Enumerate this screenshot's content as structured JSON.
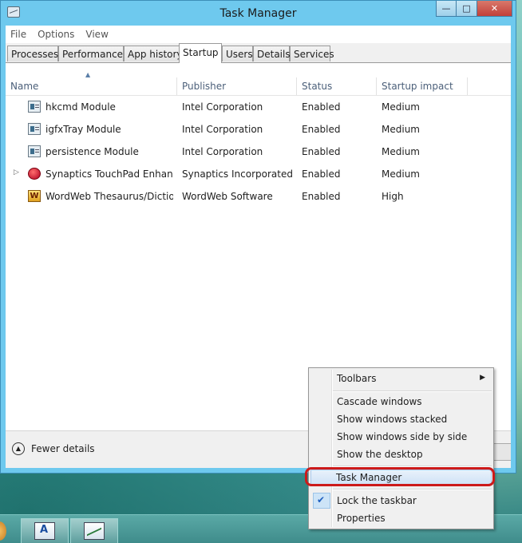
{
  "window": {
    "title": "Task Manager"
  },
  "menu": [
    "File",
    "Options",
    "View"
  ],
  "tabs": [
    "Processes",
    "Performance",
    "App history",
    "Startup",
    "Users",
    "Details",
    "Services"
  ],
  "active_tab": "Startup",
  "columns": [
    "Name",
    "Publisher",
    "Status",
    "Startup impact"
  ],
  "rows": [
    {
      "name": "hkcmd Module",
      "publisher": "Intel Corporation",
      "status": "Enabled",
      "impact": "Medium",
      "icon": "module-icon"
    },
    {
      "name": "igfxTray Module",
      "publisher": "Intel Corporation",
      "status": "Enabled",
      "impact": "Medium",
      "icon": "module-icon"
    },
    {
      "name": "persistence Module",
      "publisher": "Intel Corporation",
      "status": "Enabled",
      "impact": "Medium",
      "icon": "module-icon"
    },
    {
      "name": "Synaptics TouchPad Enhanc...",
      "publisher": "Synaptics Incorporated",
      "status": "Enabled",
      "impact": "Medium",
      "icon": "synaptics-icon"
    },
    {
      "name": "WordWeb Thesaurus/Dictio...",
      "publisher": "WordWeb Software",
      "status": "Enabled",
      "impact": "High",
      "icon": "wordweb-icon"
    }
  ],
  "footer": {
    "fewer_details": "Fewer details"
  },
  "context_menu": {
    "toolbars": "Toolbars",
    "cascade": "Cascade windows",
    "stacked": "Show windows stacked",
    "side_by_side": "Show windows side by side",
    "desktop": "Show the desktop",
    "task_manager": "Task Manager",
    "lock": "Lock the taskbar",
    "properties": "Properties"
  },
  "colors": {
    "highlight_ring": "#cc1a1a",
    "window_frame": "#6ec9ee"
  }
}
